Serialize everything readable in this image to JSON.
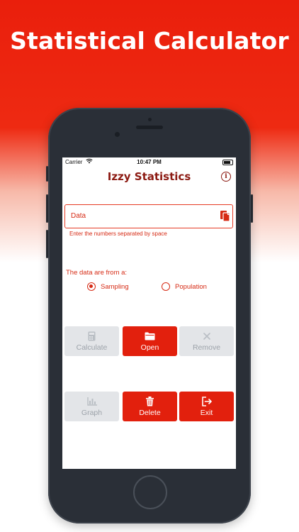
{
  "promo": {
    "headline": "Statistical Calculator"
  },
  "status_bar": {
    "carrier": "Carrier",
    "time": "10:47 PM"
  },
  "app": {
    "title": "Izzy Statistics"
  },
  "data_input": {
    "label": "Data",
    "helper_text": "Enter the numbers separated by space"
  },
  "source": {
    "question": "The data are from a:",
    "options": [
      {
        "label": "Sampling",
        "selected": true
      },
      {
        "label": "Population",
        "selected": false
      }
    ]
  },
  "buttons": {
    "calculate": {
      "label": "Calculate",
      "enabled": false,
      "icon": "calculator-icon"
    },
    "open": {
      "label": "Open",
      "enabled": true,
      "icon": "folder-icon"
    },
    "remove": {
      "label": "Remove",
      "enabled": false,
      "icon": "x-icon"
    },
    "graph": {
      "label": "Graph",
      "enabled": false,
      "icon": "bar-chart-icon"
    },
    "delete": {
      "label": "Delete",
      "enabled": true,
      "icon": "trash-icon"
    },
    "exit": {
      "label": "Exit",
      "enabled": true,
      "icon": "exit-icon"
    }
  },
  "colors": {
    "accent": "#e2200d",
    "title": "#8c1a12",
    "disabled_bg": "#e3e5e8",
    "disabled_text": "#9da3aa",
    "phone_body": "#2a2f37"
  }
}
